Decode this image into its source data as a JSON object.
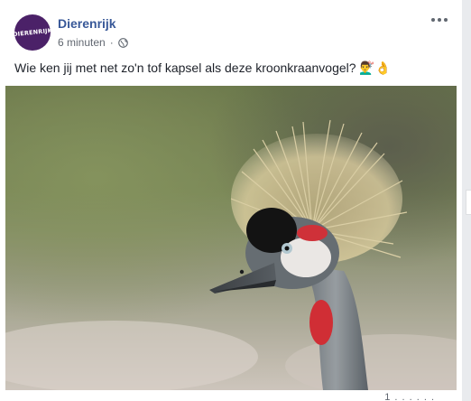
{
  "post": {
    "page_name": "Dierenrijk",
    "avatar_text": "DIERENRIJK",
    "timestamp": "6 minuten",
    "separator": "·",
    "privacy_icon": "globe-icon",
    "more_icon": "more-options-icon",
    "text": "Wie ken jij met net zo'n tof kapsel als deze kroonkraanvogel? 💇‍♂️👌",
    "image_subject": "kroonkraanvogel",
    "footer_partial": "1 . . . . . ."
  },
  "colors": {
    "link_blue": "#385898",
    "brand_purple": "#4b2168",
    "meta_gray": "#616770",
    "text_dark": "#1d2129",
    "page_bg": "#e9ebee"
  }
}
